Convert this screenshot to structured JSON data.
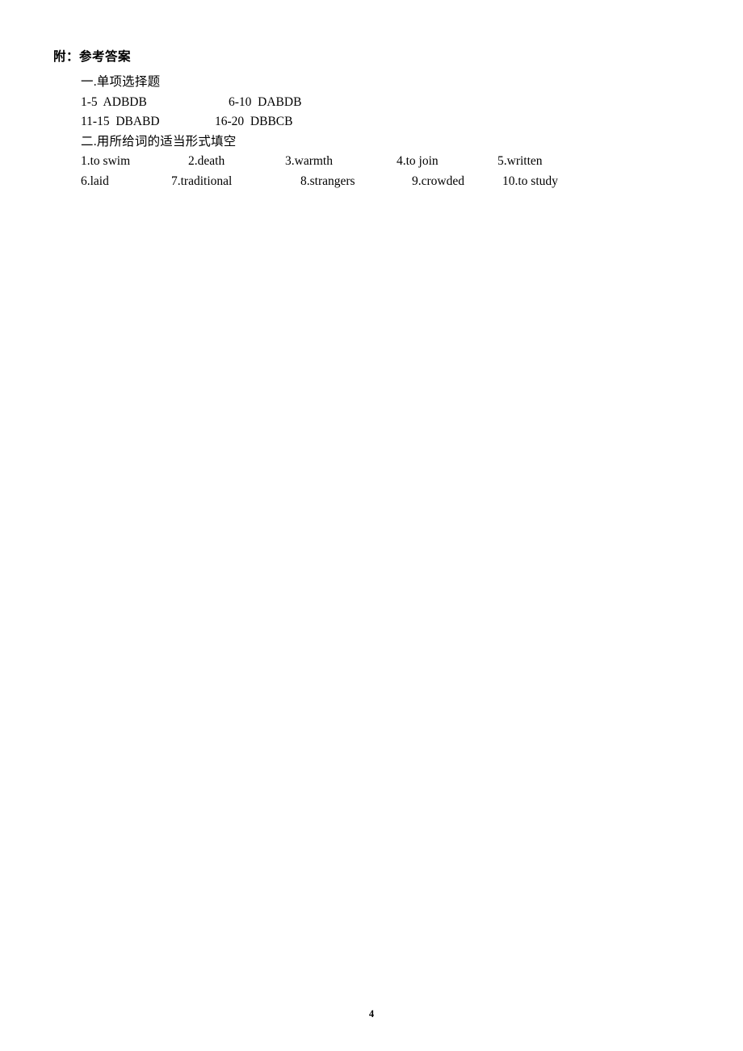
{
  "document": {
    "heading": "附：参考答案",
    "page_number": "4"
  },
  "sections": [
    {
      "title": "一.单项选择题",
      "type": "multiple-choice",
      "answer_lines": [
        {
          "left": "1-5  ADBDB",
          "right": "6-10  DABDB"
        },
        {
          "left": "11-15  DBABD",
          "right": "16-20  DBBCB"
        }
      ]
    },
    {
      "title": "二.用所给词的适当形式填空",
      "type": "word-form",
      "items_row1": [
        "1.to swim",
        "2.death",
        "3.warmth",
        "4.to join",
        "5.written"
      ],
      "items_row2": [
        "6.laid",
        "7.traditional",
        "8.strangers",
        "9.crowded",
        "10.to study"
      ]
    }
  ]
}
